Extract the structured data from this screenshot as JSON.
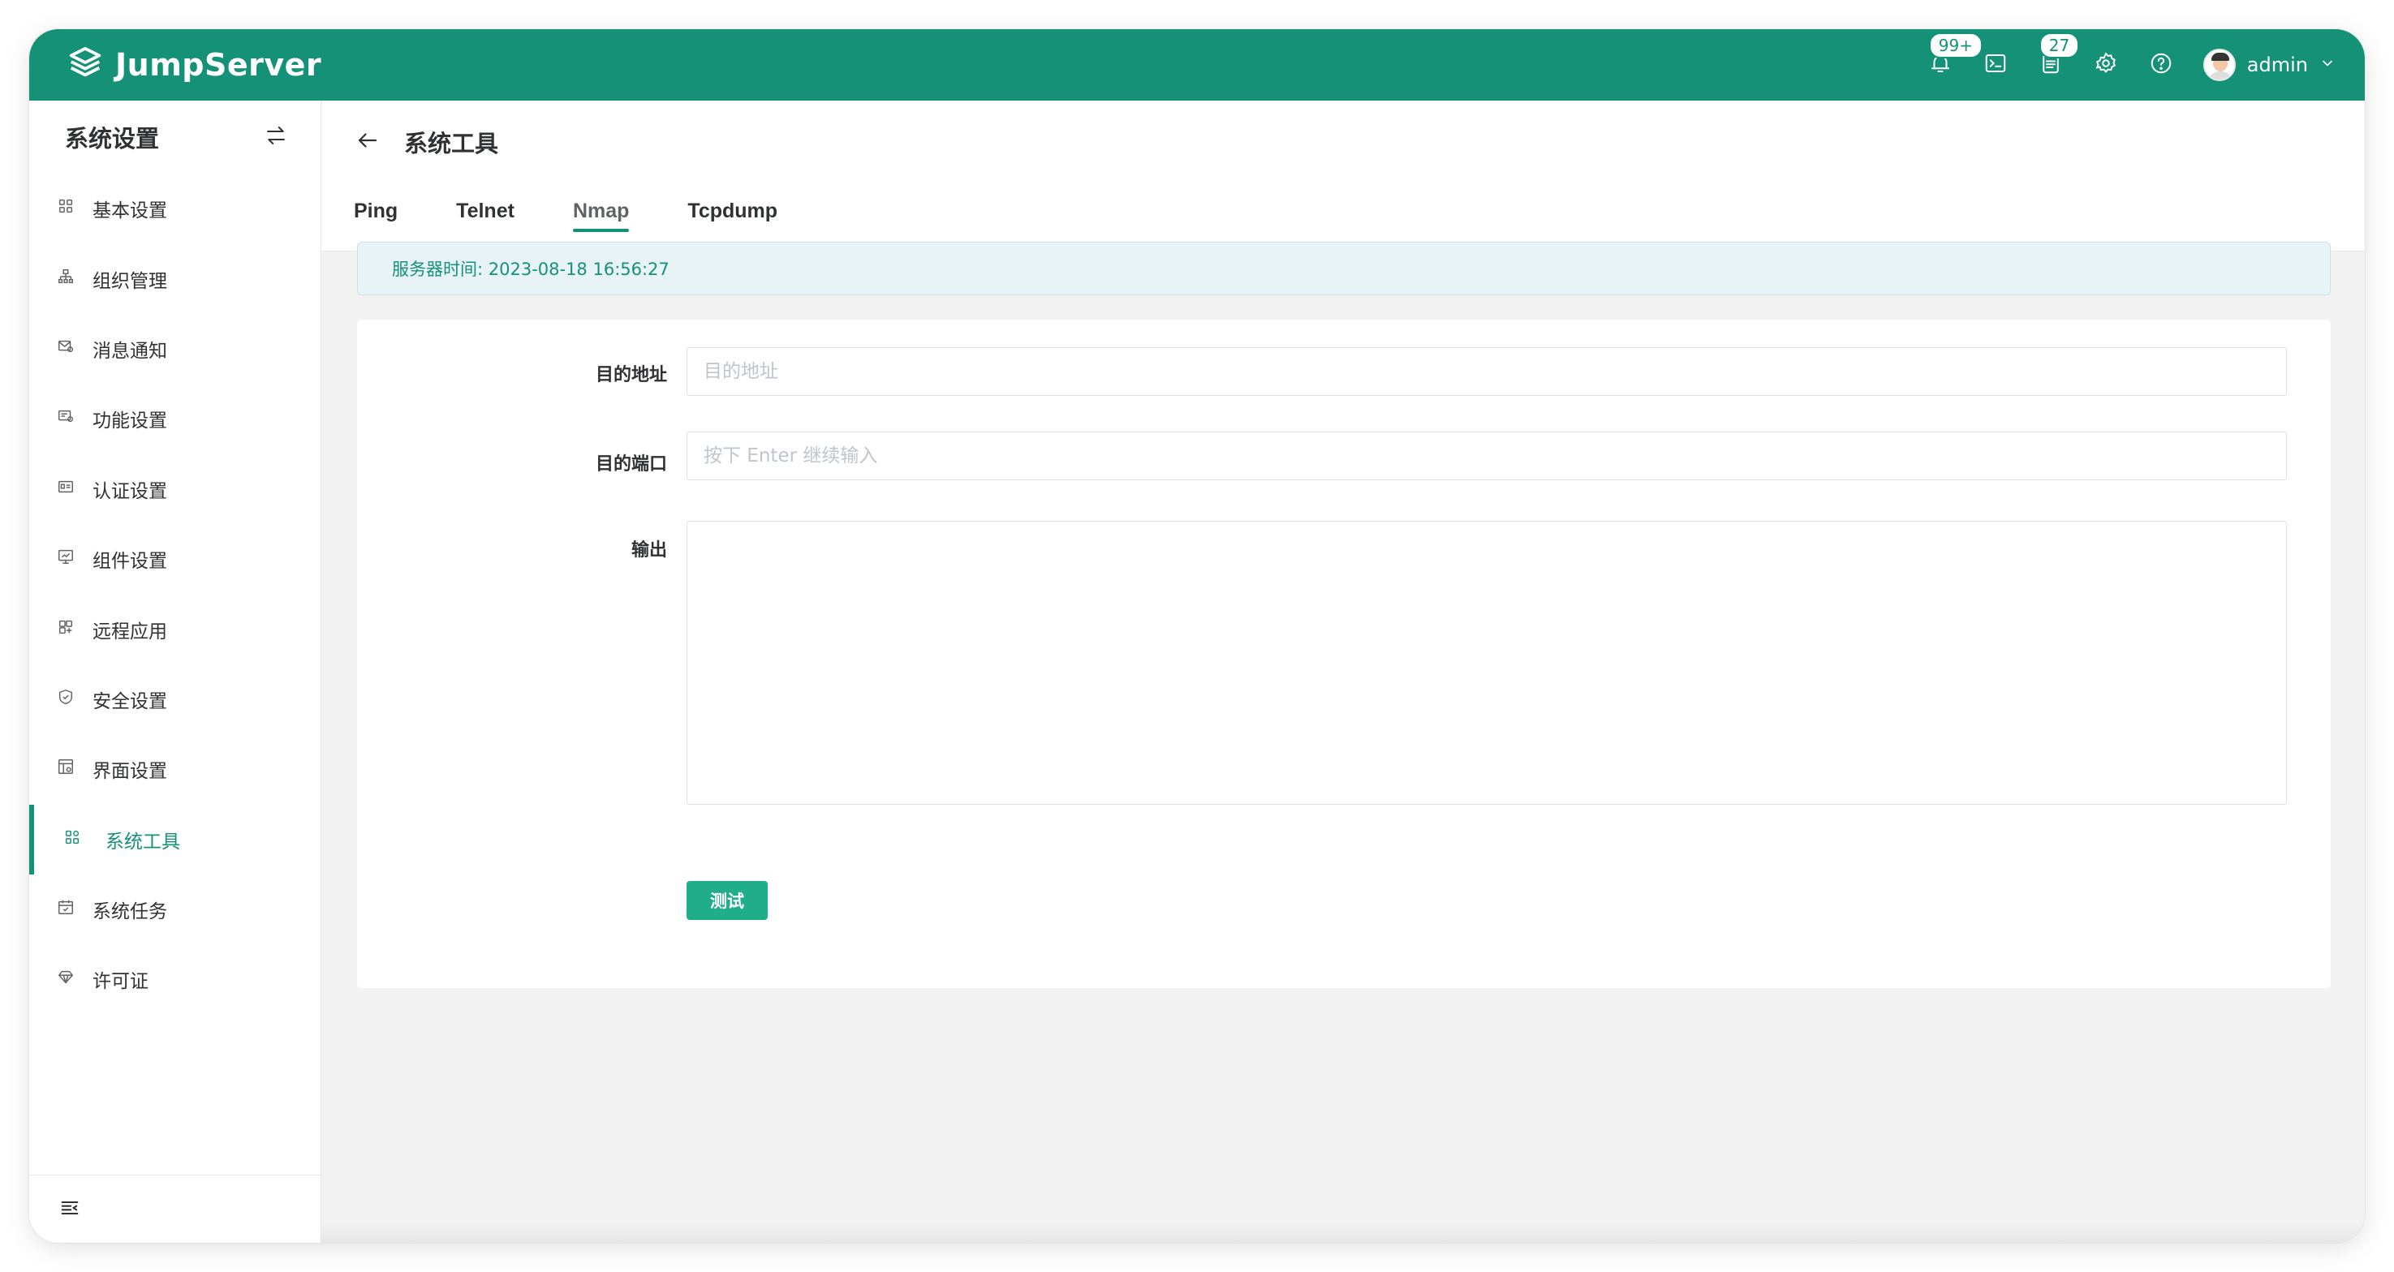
{
  "brand": {
    "name": "JumpServer"
  },
  "header": {
    "notifications_badge": "99+",
    "tasks_badge": "27",
    "username": "admin"
  },
  "sidebar": {
    "title": "系统设置",
    "items": [
      {
        "label": "基本设置",
        "icon": "grid-icon"
      },
      {
        "label": "组织管理",
        "icon": "org-tree-icon"
      },
      {
        "label": "消息通知",
        "icon": "message-icon"
      },
      {
        "label": "功能设置",
        "icon": "feature-icon"
      },
      {
        "label": "认证设置",
        "icon": "id-card-icon"
      },
      {
        "label": "组件设置",
        "icon": "monitor-icon"
      },
      {
        "label": "远程应用",
        "icon": "apps-icon"
      },
      {
        "label": "安全设置",
        "icon": "shield-icon"
      },
      {
        "label": "界面设置",
        "icon": "layout-icon"
      },
      {
        "label": "系统工具",
        "icon": "tools-icon",
        "active": true
      },
      {
        "label": "系统任务",
        "icon": "calendar-icon"
      },
      {
        "label": "许可证",
        "icon": "diamond-icon"
      }
    ]
  },
  "page": {
    "title": "系统工具",
    "tabs": [
      {
        "label": "Ping"
      },
      {
        "label": "Telnet"
      },
      {
        "label": "Nmap",
        "active": true
      },
      {
        "label": "Tcpdump"
      }
    ],
    "server_time": "服务器时间: 2023-08-18 16:56:27"
  },
  "form": {
    "target_label": "目的地址",
    "target_placeholder": "目的地址",
    "target_value": "",
    "port_label": "目的端口",
    "port_placeholder": "按下 Enter 继续输入",
    "port_value": "",
    "output_label": "输出",
    "output_value": "",
    "test_button": "测试"
  },
  "colors": {
    "primary": "#159177",
    "button": "#1fae89",
    "alert_bg": "#e8f3f8"
  }
}
